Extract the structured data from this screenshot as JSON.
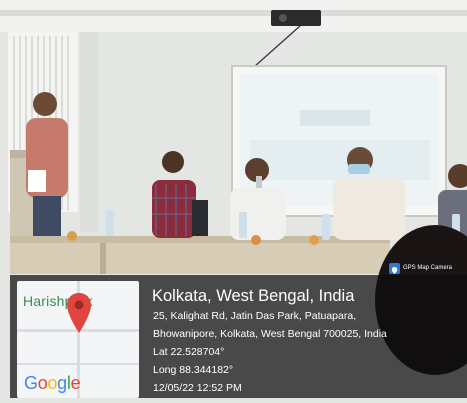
{
  "photo": {
    "subject": "Speaker at podium with panel seated at table"
  },
  "overlay": {
    "badge": "GPS Map Camera",
    "map_label": "Harishpark",
    "map_brand": [
      "G",
      "o",
      "o",
      "g",
      "l",
      "e"
    ],
    "title": "Kolkata, West Bengal, India",
    "address_line1": "25, Kalighat Rd, Jatin Das Park, Patuapara,",
    "address_line2": "Bhowanipore, Kolkata, West Bengal 700025, India",
    "lat": "Lat 22.528704°",
    "long": "Long 88.344182°",
    "datetime": "12/05/22 12:52 PM"
  },
  "colors": {
    "overlay_bg": "#0c0c0e",
    "pin": "#e0463f",
    "google_blue": "#4285f4",
    "google_red": "#ea4335",
    "google_yellow": "#fbbc05",
    "google_green": "#34a853"
  }
}
